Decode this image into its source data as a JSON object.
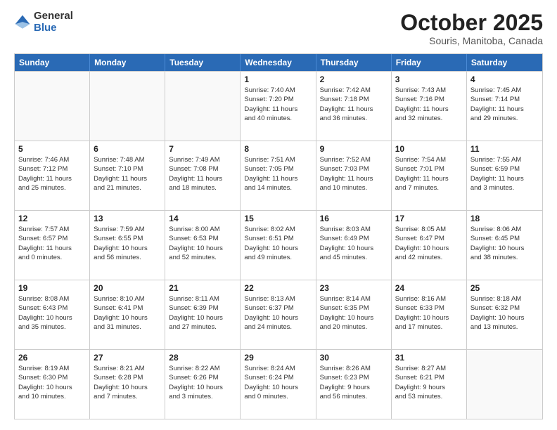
{
  "logo": {
    "general": "General",
    "blue": "Blue"
  },
  "title": {
    "month": "October 2025",
    "location": "Souris, Manitoba, Canada"
  },
  "calendar": {
    "headers": [
      "Sunday",
      "Monday",
      "Tuesday",
      "Wednesday",
      "Thursday",
      "Friday",
      "Saturday"
    ],
    "rows": [
      [
        {
          "day": "",
          "info": ""
        },
        {
          "day": "",
          "info": ""
        },
        {
          "day": "",
          "info": ""
        },
        {
          "day": "1",
          "info": "Sunrise: 7:40 AM\nSunset: 7:20 PM\nDaylight: 11 hours\nand 40 minutes."
        },
        {
          "day": "2",
          "info": "Sunrise: 7:42 AM\nSunset: 7:18 PM\nDaylight: 11 hours\nand 36 minutes."
        },
        {
          "day": "3",
          "info": "Sunrise: 7:43 AM\nSunset: 7:16 PM\nDaylight: 11 hours\nand 32 minutes."
        },
        {
          "day": "4",
          "info": "Sunrise: 7:45 AM\nSunset: 7:14 PM\nDaylight: 11 hours\nand 29 minutes."
        }
      ],
      [
        {
          "day": "5",
          "info": "Sunrise: 7:46 AM\nSunset: 7:12 PM\nDaylight: 11 hours\nand 25 minutes."
        },
        {
          "day": "6",
          "info": "Sunrise: 7:48 AM\nSunset: 7:10 PM\nDaylight: 11 hours\nand 21 minutes."
        },
        {
          "day": "7",
          "info": "Sunrise: 7:49 AM\nSunset: 7:08 PM\nDaylight: 11 hours\nand 18 minutes."
        },
        {
          "day": "8",
          "info": "Sunrise: 7:51 AM\nSunset: 7:05 PM\nDaylight: 11 hours\nand 14 minutes."
        },
        {
          "day": "9",
          "info": "Sunrise: 7:52 AM\nSunset: 7:03 PM\nDaylight: 11 hours\nand 10 minutes."
        },
        {
          "day": "10",
          "info": "Sunrise: 7:54 AM\nSunset: 7:01 PM\nDaylight: 11 hours\nand 7 minutes."
        },
        {
          "day": "11",
          "info": "Sunrise: 7:55 AM\nSunset: 6:59 PM\nDaylight: 11 hours\nand 3 minutes."
        }
      ],
      [
        {
          "day": "12",
          "info": "Sunrise: 7:57 AM\nSunset: 6:57 PM\nDaylight: 11 hours\nand 0 minutes."
        },
        {
          "day": "13",
          "info": "Sunrise: 7:59 AM\nSunset: 6:55 PM\nDaylight: 10 hours\nand 56 minutes."
        },
        {
          "day": "14",
          "info": "Sunrise: 8:00 AM\nSunset: 6:53 PM\nDaylight: 10 hours\nand 52 minutes."
        },
        {
          "day": "15",
          "info": "Sunrise: 8:02 AM\nSunset: 6:51 PM\nDaylight: 10 hours\nand 49 minutes."
        },
        {
          "day": "16",
          "info": "Sunrise: 8:03 AM\nSunset: 6:49 PM\nDaylight: 10 hours\nand 45 minutes."
        },
        {
          "day": "17",
          "info": "Sunrise: 8:05 AM\nSunset: 6:47 PM\nDaylight: 10 hours\nand 42 minutes."
        },
        {
          "day": "18",
          "info": "Sunrise: 8:06 AM\nSunset: 6:45 PM\nDaylight: 10 hours\nand 38 minutes."
        }
      ],
      [
        {
          "day": "19",
          "info": "Sunrise: 8:08 AM\nSunset: 6:43 PM\nDaylight: 10 hours\nand 35 minutes."
        },
        {
          "day": "20",
          "info": "Sunrise: 8:10 AM\nSunset: 6:41 PM\nDaylight: 10 hours\nand 31 minutes."
        },
        {
          "day": "21",
          "info": "Sunrise: 8:11 AM\nSunset: 6:39 PM\nDaylight: 10 hours\nand 27 minutes."
        },
        {
          "day": "22",
          "info": "Sunrise: 8:13 AM\nSunset: 6:37 PM\nDaylight: 10 hours\nand 24 minutes."
        },
        {
          "day": "23",
          "info": "Sunrise: 8:14 AM\nSunset: 6:35 PM\nDaylight: 10 hours\nand 20 minutes."
        },
        {
          "day": "24",
          "info": "Sunrise: 8:16 AM\nSunset: 6:33 PM\nDaylight: 10 hours\nand 17 minutes."
        },
        {
          "day": "25",
          "info": "Sunrise: 8:18 AM\nSunset: 6:32 PM\nDaylight: 10 hours\nand 13 minutes."
        }
      ],
      [
        {
          "day": "26",
          "info": "Sunrise: 8:19 AM\nSunset: 6:30 PM\nDaylight: 10 hours\nand 10 minutes."
        },
        {
          "day": "27",
          "info": "Sunrise: 8:21 AM\nSunset: 6:28 PM\nDaylight: 10 hours\nand 7 minutes."
        },
        {
          "day": "28",
          "info": "Sunrise: 8:22 AM\nSunset: 6:26 PM\nDaylight: 10 hours\nand 3 minutes."
        },
        {
          "day": "29",
          "info": "Sunrise: 8:24 AM\nSunset: 6:24 PM\nDaylight: 10 hours\nand 0 minutes."
        },
        {
          "day": "30",
          "info": "Sunrise: 8:26 AM\nSunset: 6:23 PM\nDaylight: 9 hours\nand 56 minutes."
        },
        {
          "day": "31",
          "info": "Sunrise: 8:27 AM\nSunset: 6:21 PM\nDaylight: 9 hours\nand 53 minutes."
        },
        {
          "day": "",
          "info": ""
        }
      ]
    ]
  }
}
